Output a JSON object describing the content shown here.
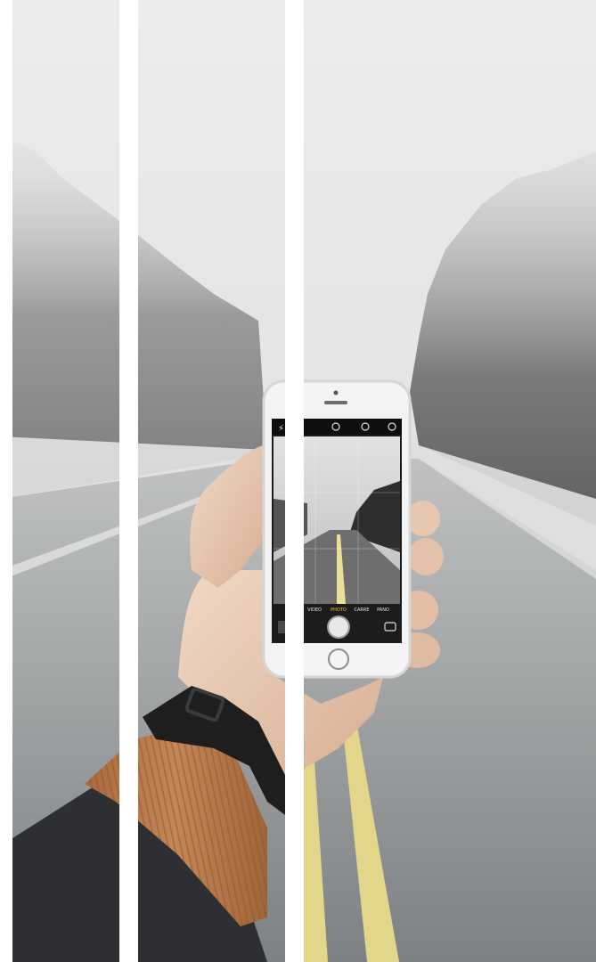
{
  "photo": {
    "panel_count": 3,
    "divider_color": "#ffffff",
    "fog_color": "#e9e9e9",
    "road_color": "#8a8c8d",
    "lane_line_color": "#ddd58e",
    "tree_color": "#6f6f6f",
    "phone_body_color": "#f4f4f4",
    "phone_bezel_color": "#dcdcdc",
    "skin_color": "#e6c8b2",
    "sleeve_color": "#b87a4c",
    "jacket_color": "#2d2f33",
    "watch_color": "#1e1e1e"
  },
  "camera_app": {
    "modes": [
      "VIDEO",
      "PHOTO",
      "CARRE",
      "PANO"
    ],
    "selected_mode": "PHOTO",
    "selected_color": "#f0c14b"
  }
}
